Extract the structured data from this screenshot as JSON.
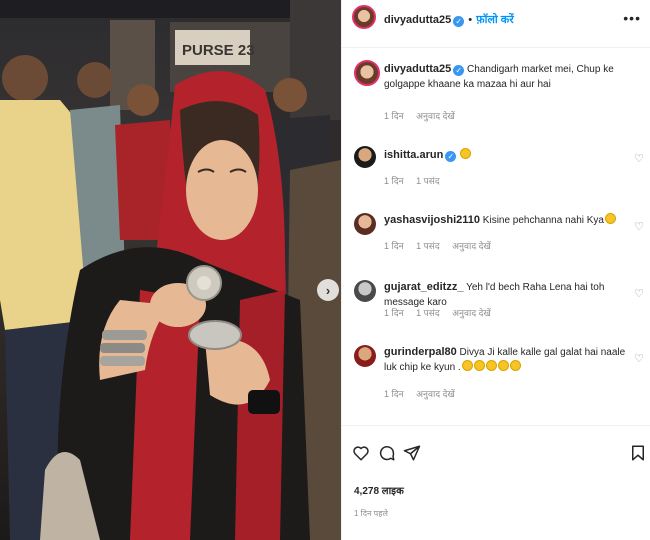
{
  "post": {
    "author": "divyadutta25",
    "follow_label": "फ़ॉलो करें",
    "more_label": "•••",
    "shop_sign": "PURSE 23",
    "caption": "Chandigarh market mei, Chup ke golgappe khaane ka mazaa hi aur hai",
    "caption_age": "1 दिन",
    "caption_translate": "अनुवाद देखें",
    "likes": "4,278 लाइक",
    "posted_ago": "1 दिन पहले"
  },
  "comments": [
    {
      "user": "ishitta.arun",
      "verified": true,
      "text": "",
      "emoji_count": 1,
      "age": "1 दिन",
      "like_label": "1 पसंद",
      "translate": ""
    },
    {
      "user": "yashasvijoshi2110",
      "verified": false,
      "text": "Kisine pehchanna nahi Kya",
      "emoji_count": 1,
      "age": "1 दिन",
      "like_label": "1 पसंद",
      "translate": "अनुवाद देखें"
    },
    {
      "user": "gujarat_editzz_",
      "verified": false,
      "text": "Yeh l'd bech Raha Lena hai toh message karo",
      "emoji_count": 0,
      "age": "1 दिन",
      "like_label": "1 पसंद",
      "translate": "अनुवाद देखें"
    },
    {
      "user": "gurinderpal80",
      "verified": false,
      "text": "Divya Ji kalle kalle gal galat hai naale luk chip ke kyun .",
      "emoji_count": 5,
      "age": "1 दिन",
      "like_label": "",
      "translate": "अनुवाद देखें"
    }
  ],
  "icons": {
    "like": "heart-icon",
    "comment": "comment-icon",
    "share": "share-icon",
    "save": "bookmark-icon",
    "next": "chevron-right-icon"
  },
  "colors": {
    "link": "#0095f6",
    "verified": "#3897f0",
    "muted": "#8e8e8e",
    "scarf": "#b4232c"
  }
}
